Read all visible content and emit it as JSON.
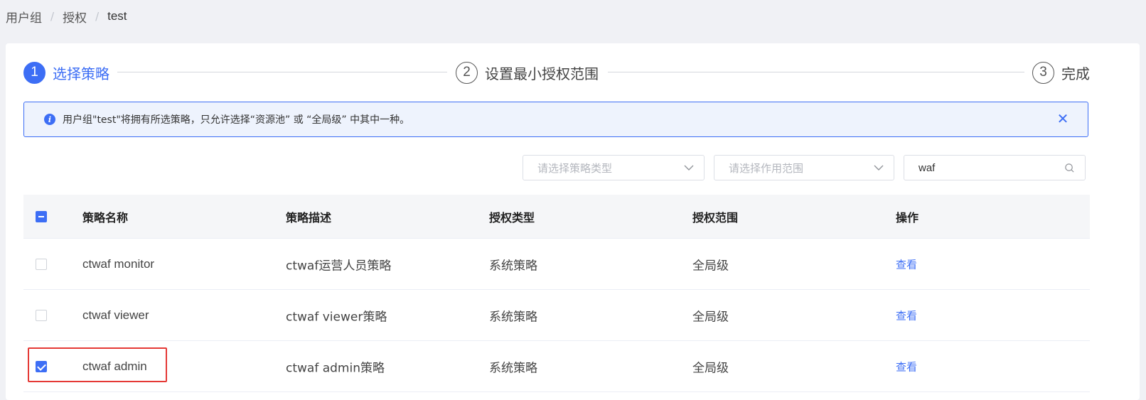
{
  "breadcrumb": {
    "items": [
      "用户组",
      "授权",
      "test"
    ],
    "separator": "/"
  },
  "steps": [
    {
      "number": "1",
      "label": "选择策略",
      "active": true
    },
    {
      "number": "2",
      "label": "设置最小授权范围",
      "active": false
    },
    {
      "number": "3",
      "label": "完成",
      "active": false
    }
  ],
  "alert": {
    "icon": "info-icon",
    "text": "用户组\"test\"将拥有所选策略，只允许选择“资源池” 或 “全局级” 中其中一种。",
    "close_icon": "close-icon"
  },
  "filters": {
    "policy_type_placeholder": "请选择策略类型",
    "scope_placeholder": "请选择作用范围",
    "search_value": "waf"
  },
  "table": {
    "headers": [
      "策略名称",
      "策略描述",
      "授权类型",
      "授权范围",
      "操作"
    ],
    "select_all_state": "indeterminate",
    "rows": [
      {
        "name": "ctwaf monitor",
        "desc": "ctwaf运营人员策略",
        "type": "系统策略",
        "scope": "全局级",
        "op": "查看",
        "checked": false
      },
      {
        "name": "ctwaf viewer",
        "desc": "ctwaf viewer策略",
        "type": "系统策略",
        "scope": "全局级",
        "op": "查看",
        "checked": false
      },
      {
        "name": "ctwaf admin",
        "desc": "ctwaf admin策略",
        "type": "系统策略",
        "scope": "全局级",
        "op": "查看",
        "checked": true
      }
    ]
  },
  "colors": {
    "accent": "#3d6ef5",
    "highlight": "#e53935"
  }
}
